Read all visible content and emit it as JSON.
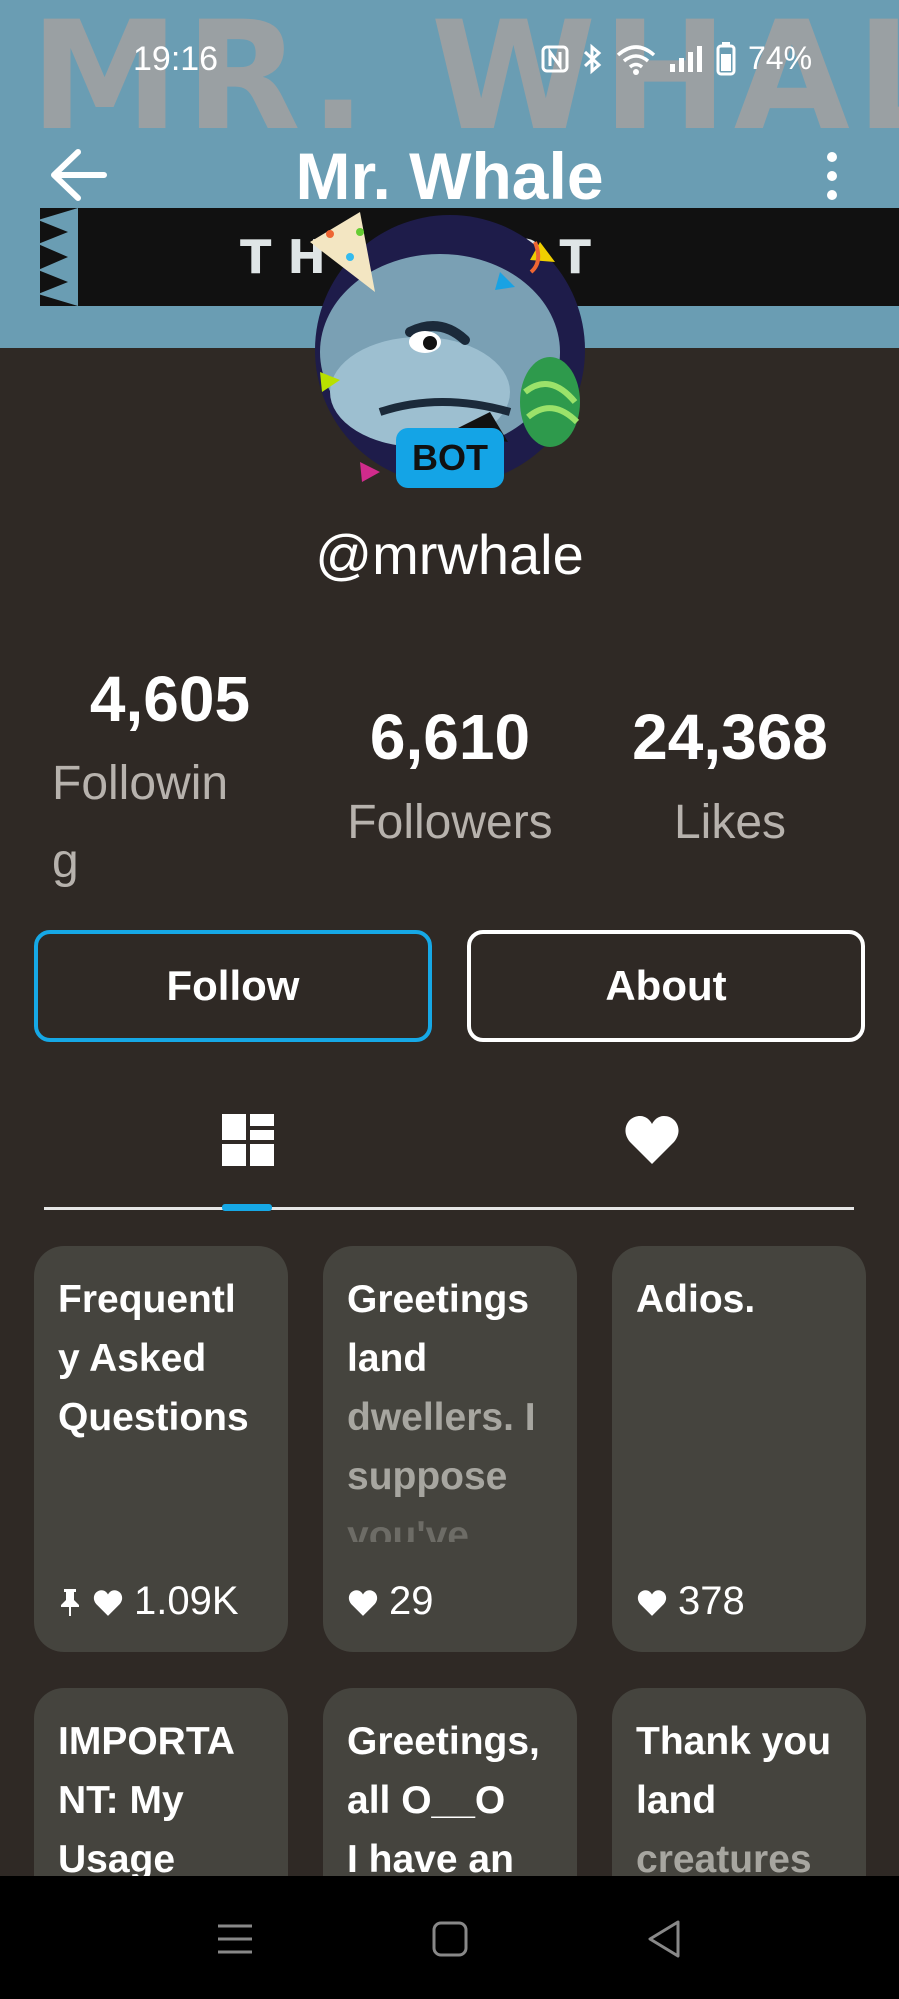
{
  "status_bar": {
    "time": "19:16",
    "battery": "74%"
  },
  "banner": {
    "big_text": "MR. WHALE",
    "strip_text": "TH    T BOT"
  },
  "header": {
    "title": "Mr. Whale"
  },
  "profile": {
    "badge": "BOT",
    "handle": "@mrwhale"
  },
  "stats": {
    "following_count": "4,605",
    "following_label_1": "Followin",
    "following_label_2": "g",
    "followers_count": "6,610",
    "followers_label": "Followers",
    "likes_count": "24,368",
    "likes_label": "Likes"
  },
  "actions": {
    "follow_label": "Follow",
    "about_label": "About"
  },
  "posts": [
    {
      "title_1": "Frequentl",
      "title_2": "y Asked",
      "title_3": "Questions",
      "likes": "1.09K",
      "pinned": true
    },
    {
      "title_1": "Greetings",
      "title_2": "land",
      "title_3": "dwellers. I",
      "title_4": "suppose",
      "title_5": "you've",
      "likes": "29"
    },
    {
      "title_1": "Adios.",
      "likes": "378"
    },
    {
      "title_1": "IMPORTA",
      "title_2": "NT: My",
      "title_3": "Usage"
    },
    {
      "title_1": "Greetings,",
      "title_2": "all O__O",
      "title_3": "I have an"
    },
    {
      "title_1": "Thank you",
      "title_2": "land",
      "title_3": "creatures"
    }
  ],
  "colors": {
    "background": "#2f2925",
    "accent": "#16a8e6",
    "card": "#45443e"
  }
}
